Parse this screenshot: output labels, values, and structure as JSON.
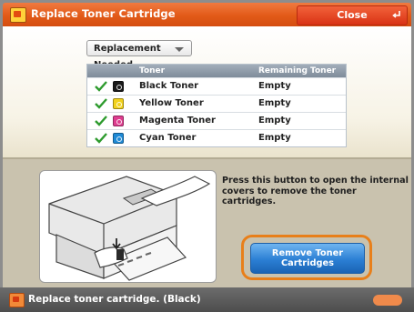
{
  "window": {
    "title": "Replace Toner Cartridge",
    "close_label": "Close"
  },
  "filter": {
    "selected": "Replacement Needed"
  },
  "table": {
    "headers": {
      "toner": "Toner",
      "remaining": "Remaining Toner"
    },
    "rows": [
      {
        "name": "Black Toner",
        "remaining": "Empty",
        "color": "#1a1a1a",
        "icon": "check-icon"
      },
      {
        "name": "Yellow Toner",
        "remaining": "Empty",
        "color": "#f2d21b",
        "icon": "check-icon"
      },
      {
        "name": "Magenta Toner",
        "remaining": "Empty",
        "color": "#de3d8f",
        "icon": "check-icon"
      },
      {
        "name": "Cyan Toner",
        "remaining": "Empty",
        "color": "#1f8ad6",
        "icon": "check-icon"
      }
    ]
  },
  "instructions": "Press this button to open the internal covers to remove the toner cartridges.",
  "remove_button": {
    "line1": "Remove Toner",
    "line2": "Cartridges"
  },
  "status_bar": {
    "message": "Replace toner cartridge. (Black)"
  },
  "colors": {
    "title_bar": "#e25a18",
    "accent_orange": "#e87f1a",
    "button_blue": "#2b7fd4",
    "check_green": "#2e9b2e"
  }
}
